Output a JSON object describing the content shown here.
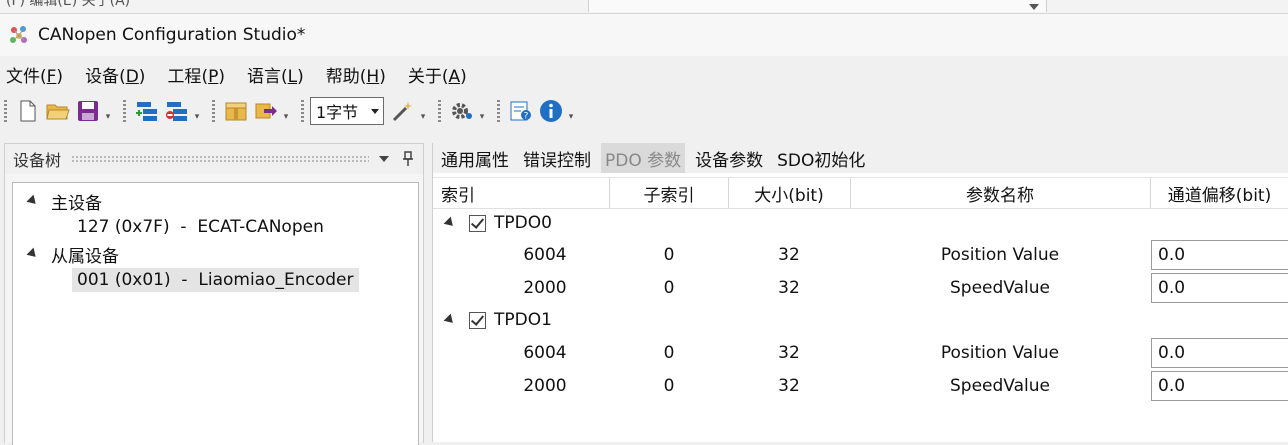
{
  "background_window": {
    "fragment": "(F)  编辑(E)  关于(A)"
  },
  "window": {
    "title": "CANopen Configuration Studio*"
  },
  "menu": [
    {
      "label": "文件",
      "key": "F"
    },
    {
      "label": "设备",
      "key": "D"
    },
    {
      "label": "工程",
      "key": "P"
    },
    {
      "label": "语言",
      "key": "L"
    },
    {
      "label": "帮助",
      "key": "H"
    },
    {
      "label": "关于",
      "key": "A"
    }
  ],
  "toolbar": {
    "size_combo_value": "1字节",
    "icons": [
      "new-file-icon",
      "open-folder-icon",
      "save-icon",
      "add-node-icon",
      "remove-node-icon",
      "package-icon",
      "export-icon",
      "magic-wand-icon",
      "settings-gear-icon",
      "help-icon",
      "info-icon"
    ]
  },
  "device_tree": {
    "title": "设备树",
    "master": {
      "label": "主设备",
      "child": "127 (0x7F)  -  ECAT-CANopen"
    },
    "slave": {
      "label": "从属设备",
      "child": "001 (0x01)  -  Liaomiao_Encoder"
    }
  },
  "tabs": [
    "通用属性",
    "错误控制",
    "PDO 参数",
    "设备参数",
    "SDO初始化"
  ],
  "active_tab": "PDO 参数",
  "grid": {
    "headers": [
      "索引",
      "子索引",
      "大小(bit)",
      "参数名称",
      "通道偏移(bit)"
    ],
    "groups": [
      {
        "name": "TPDO0",
        "checked": true,
        "rows": [
          {
            "index": "6004",
            "subindex": "0",
            "size": "32",
            "name": "Position Value",
            "offset": "0.0"
          },
          {
            "index": "2000",
            "subindex": "0",
            "size": "32",
            "name": "SpeedValue",
            "offset": "0.0"
          }
        ]
      },
      {
        "name": "TPDO1",
        "checked": true,
        "rows": [
          {
            "index": "6004",
            "subindex": "0",
            "size": "32",
            "name": "Position Value",
            "offset": "0.0"
          },
          {
            "index": "2000",
            "subindex": "0",
            "size": "32",
            "name": "SpeedValue",
            "offset": "0.0"
          }
        ]
      }
    ]
  },
  "colors": {
    "accent_blue": "#1f6fc5",
    "save_purple": "#7b2d8e",
    "folder_yellow": "#e8b84a"
  }
}
